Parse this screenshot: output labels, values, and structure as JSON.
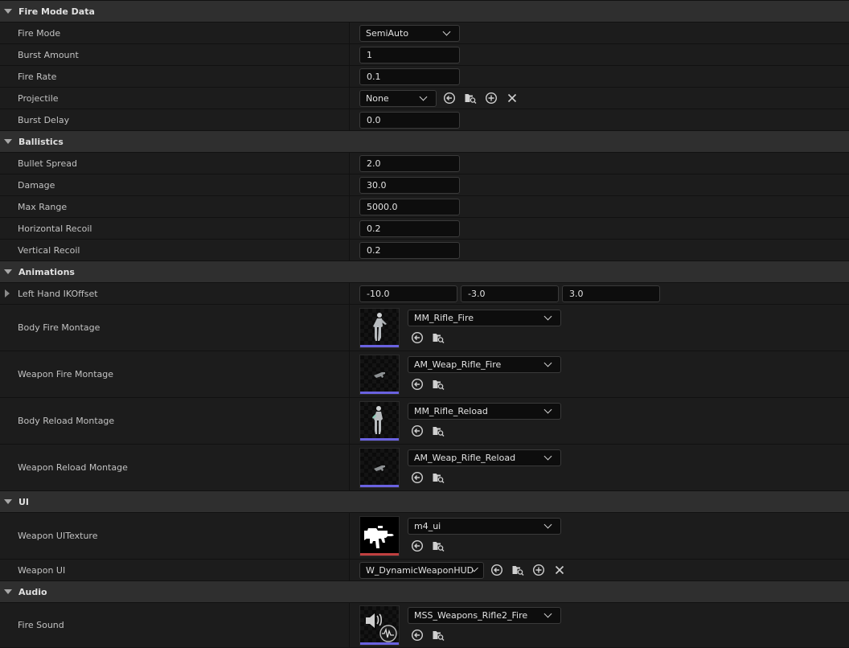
{
  "sections": {
    "fire_mode": {
      "title": "Fire Mode Data",
      "fire_mode": {
        "label": "Fire Mode",
        "value": "SemiAuto"
      },
      "burst_amount": {
        "label": "Burst Amount",
        "value": "1"
      },
      "fire_rate": {
        "label": "Fire Rate",
        "value": "0.1"
      },
      "projectile": {
        "label": "Projectile",
        "value": "None"
      },
      "burst_delay": {
        "label": "Burst Delay",
        "value": "0.0"
      }
    },
    "ballistics": {
      "title": "Ballistics",
      "bullet_spread": {
        "label": "Bullet Spread",
        "value": "2.0"
      },
      "damage": {
        "label": "Damage",
        "value": "30.0"
      },
      "max_range": {
        "label": "Max Range",
        "value": "5000.0"
      },
      "horizontal_recoil": {
        "label": "Horizontal Recoil",
        "value": "0.2"
      },
      "vertical_recoil": {
        "label": "Vertical Recoil",
        "value": "0.2"
      }
    },
    "animations": {
      "title": "Animations",
      "left_hand_ik": {
        "label": "Left Hand IKOffset",
        "x": "-10.0",
        "y": "-3.0",
        "z": "3.0"
      },
      "body_fire": {
        "label": "Body Fire Montage",
        "asset": "MM_Rifle_Fire",
        "thumb_icon": "character-mannequin-icon"
      },
      "weapon_fire": {
        "label": "Weapon Fire Montage",
        "asset": "AM_Weap_Rifle_Fire",
        "thumb_icon": "rifle-icon"
      },
      "body_reload": {
        "label": "Body Reload Montage",
        "asset": "MM_Rifle_Reload",
        "thumb_icon": "character-mannequin-icon"
      },
      "weapon_reload": {
        "label": "Weapon Reload Montage",
        "asset": "AM_Weap_Rifle_Reload",
        "thumb_icon": "rifle-icon"
      }
    },
    "ui": {
      "title": "UI",
      "weapon_ui_texture": {
        "label": "Weapon UITexture",
        "asset": "m4_ui",
        "thumb_icon": "m4-silhouette-icon"
      },
      "weapon_ui": {
        "label": "Weapon UI",
        "value": "W_DynamicWeaponHUD"
      }
    },
    "audio": {
      "title": "Audio",
      "fire_sound": {
        "label": "Fire Sound",
        "asset": "MSS_Weapons_Rifle2_Fire",
        "thumb_icon": "sound-wave-icon"
      }
    }
  },
  "colors": {
    "montage_bar": "#6a62e0",
    "texture_bar": "#c04040"
  }
}
